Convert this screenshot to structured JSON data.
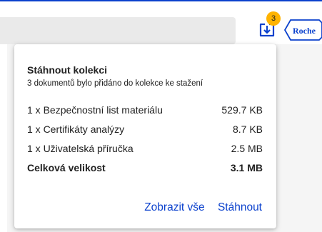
{
  "header": {
    "download_badge_count": "3",
    "logo_text": "Roche",
    "colors": {
      "accent": "#0b41cd",
      "badge": "#ffb300"
    }
  },
  "popover": {
    "title": "Stáhnout kolekci",
    "subtitle": "3 dokumentů bylo přidáno do kolekce ke stažení",
    "items": [
      {
        "name": "1 x Bezpečnostní list materiálu",
        "size": "529.7 KB"
      },
      {
        "name": "1 x Certifikáty analýzy",
        "size": "8.7 KB"
      },
      {
        "name": "1 x Uživatelská příručka",
        "size": "2.5 MB"
      }
    ],
    "total": {
      "label": "Celková velikost",
      "size": "3.1 MB"
    },
    "show_all_label": "Zobrazit vše",
    "download_label": "Stáhnout"
  }
}
